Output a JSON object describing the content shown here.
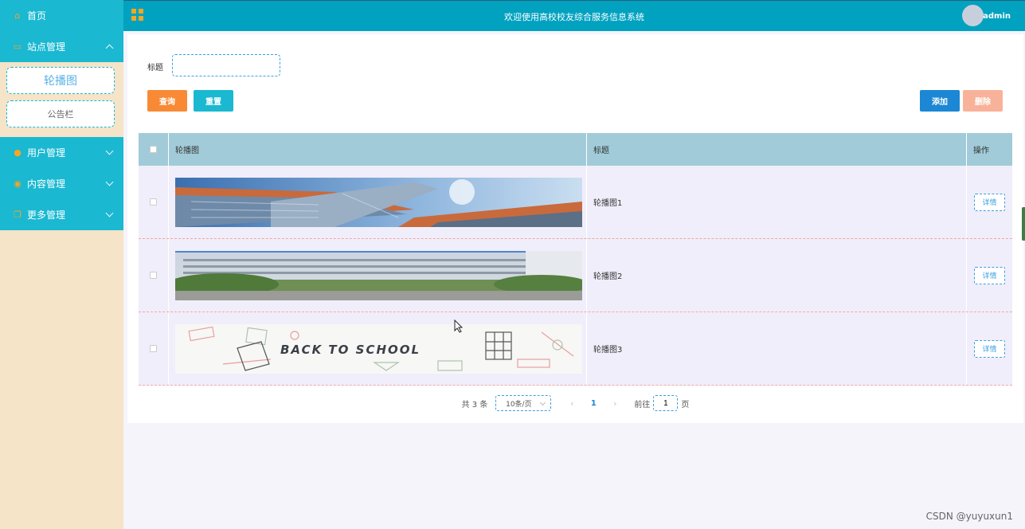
{
  "sidebar": {
    "home": {
      "label": "首页",
      "icon": "home-icon"
    },
    "site_management": {
      "label": "站点管理",
      "icon": "monitor-icon",
      "expanded": true,
      "items": [
        {
          "label": "轮播图",
          "active": true
        },
        {
          "label": "公告栏",
          "active": false
        }
      ]
    },
    "user_management": {
      "label": "用户管理",
      "icon": "user-icon"
    },
    "content_management": {
      "label": "内容管理",
      "icon": "content-icon"
    },
    "more_management": {
      "label": "更多管理",
      "icon": "copy-icon"
    }
  },
  "header": {
    "title": "欢迎使用高校校友综合服务信息系统",
    "username": "admin"
  },
  "search": {
    "label": "标题",
    "value": "",
    "query_button": "查询",
    "reset_button": "重置"
  },
  "actions": {
    "add_button": "添加",
    "delete_button": "删除"
  },
  "table": {
    "columns": [
      "轮播图",
      "标题",
      "操作"
    ],
    "rows": [
      {
        "image": "modern-building-photo",
        "title": "轮播图1",
        "action": "详情"
      },
      {
        "image": "campus-building-photo",
        "title": "轮播图2",
        "action": "详情"
      },
      {
        "image": "back-to-school-banner",
        "image_text": "BACK TO SCHOOL",
        "title": "轮播图3",
        "action": "详情"
      }
    ]
  },
  "pagination": {
    "total": "共 3 条",
    "page_size": "10条/页",
    "current_page": "1",
    "goto_label": "前往",
    "goto_value": "1",
    "goto_suffix": "页"
  },
  "watermark": "CSDN @yuyuxun1",
  "colors": {
    "sidebar_active": "#1ab8d1",
    "topbar": "#00a2c0",
    "query_button": "#f98a35",
    "add_button": "#1c87d4",
    "delete_button": "#f9b29a",
    "table_header": "#a1cbd8"
  }
}
